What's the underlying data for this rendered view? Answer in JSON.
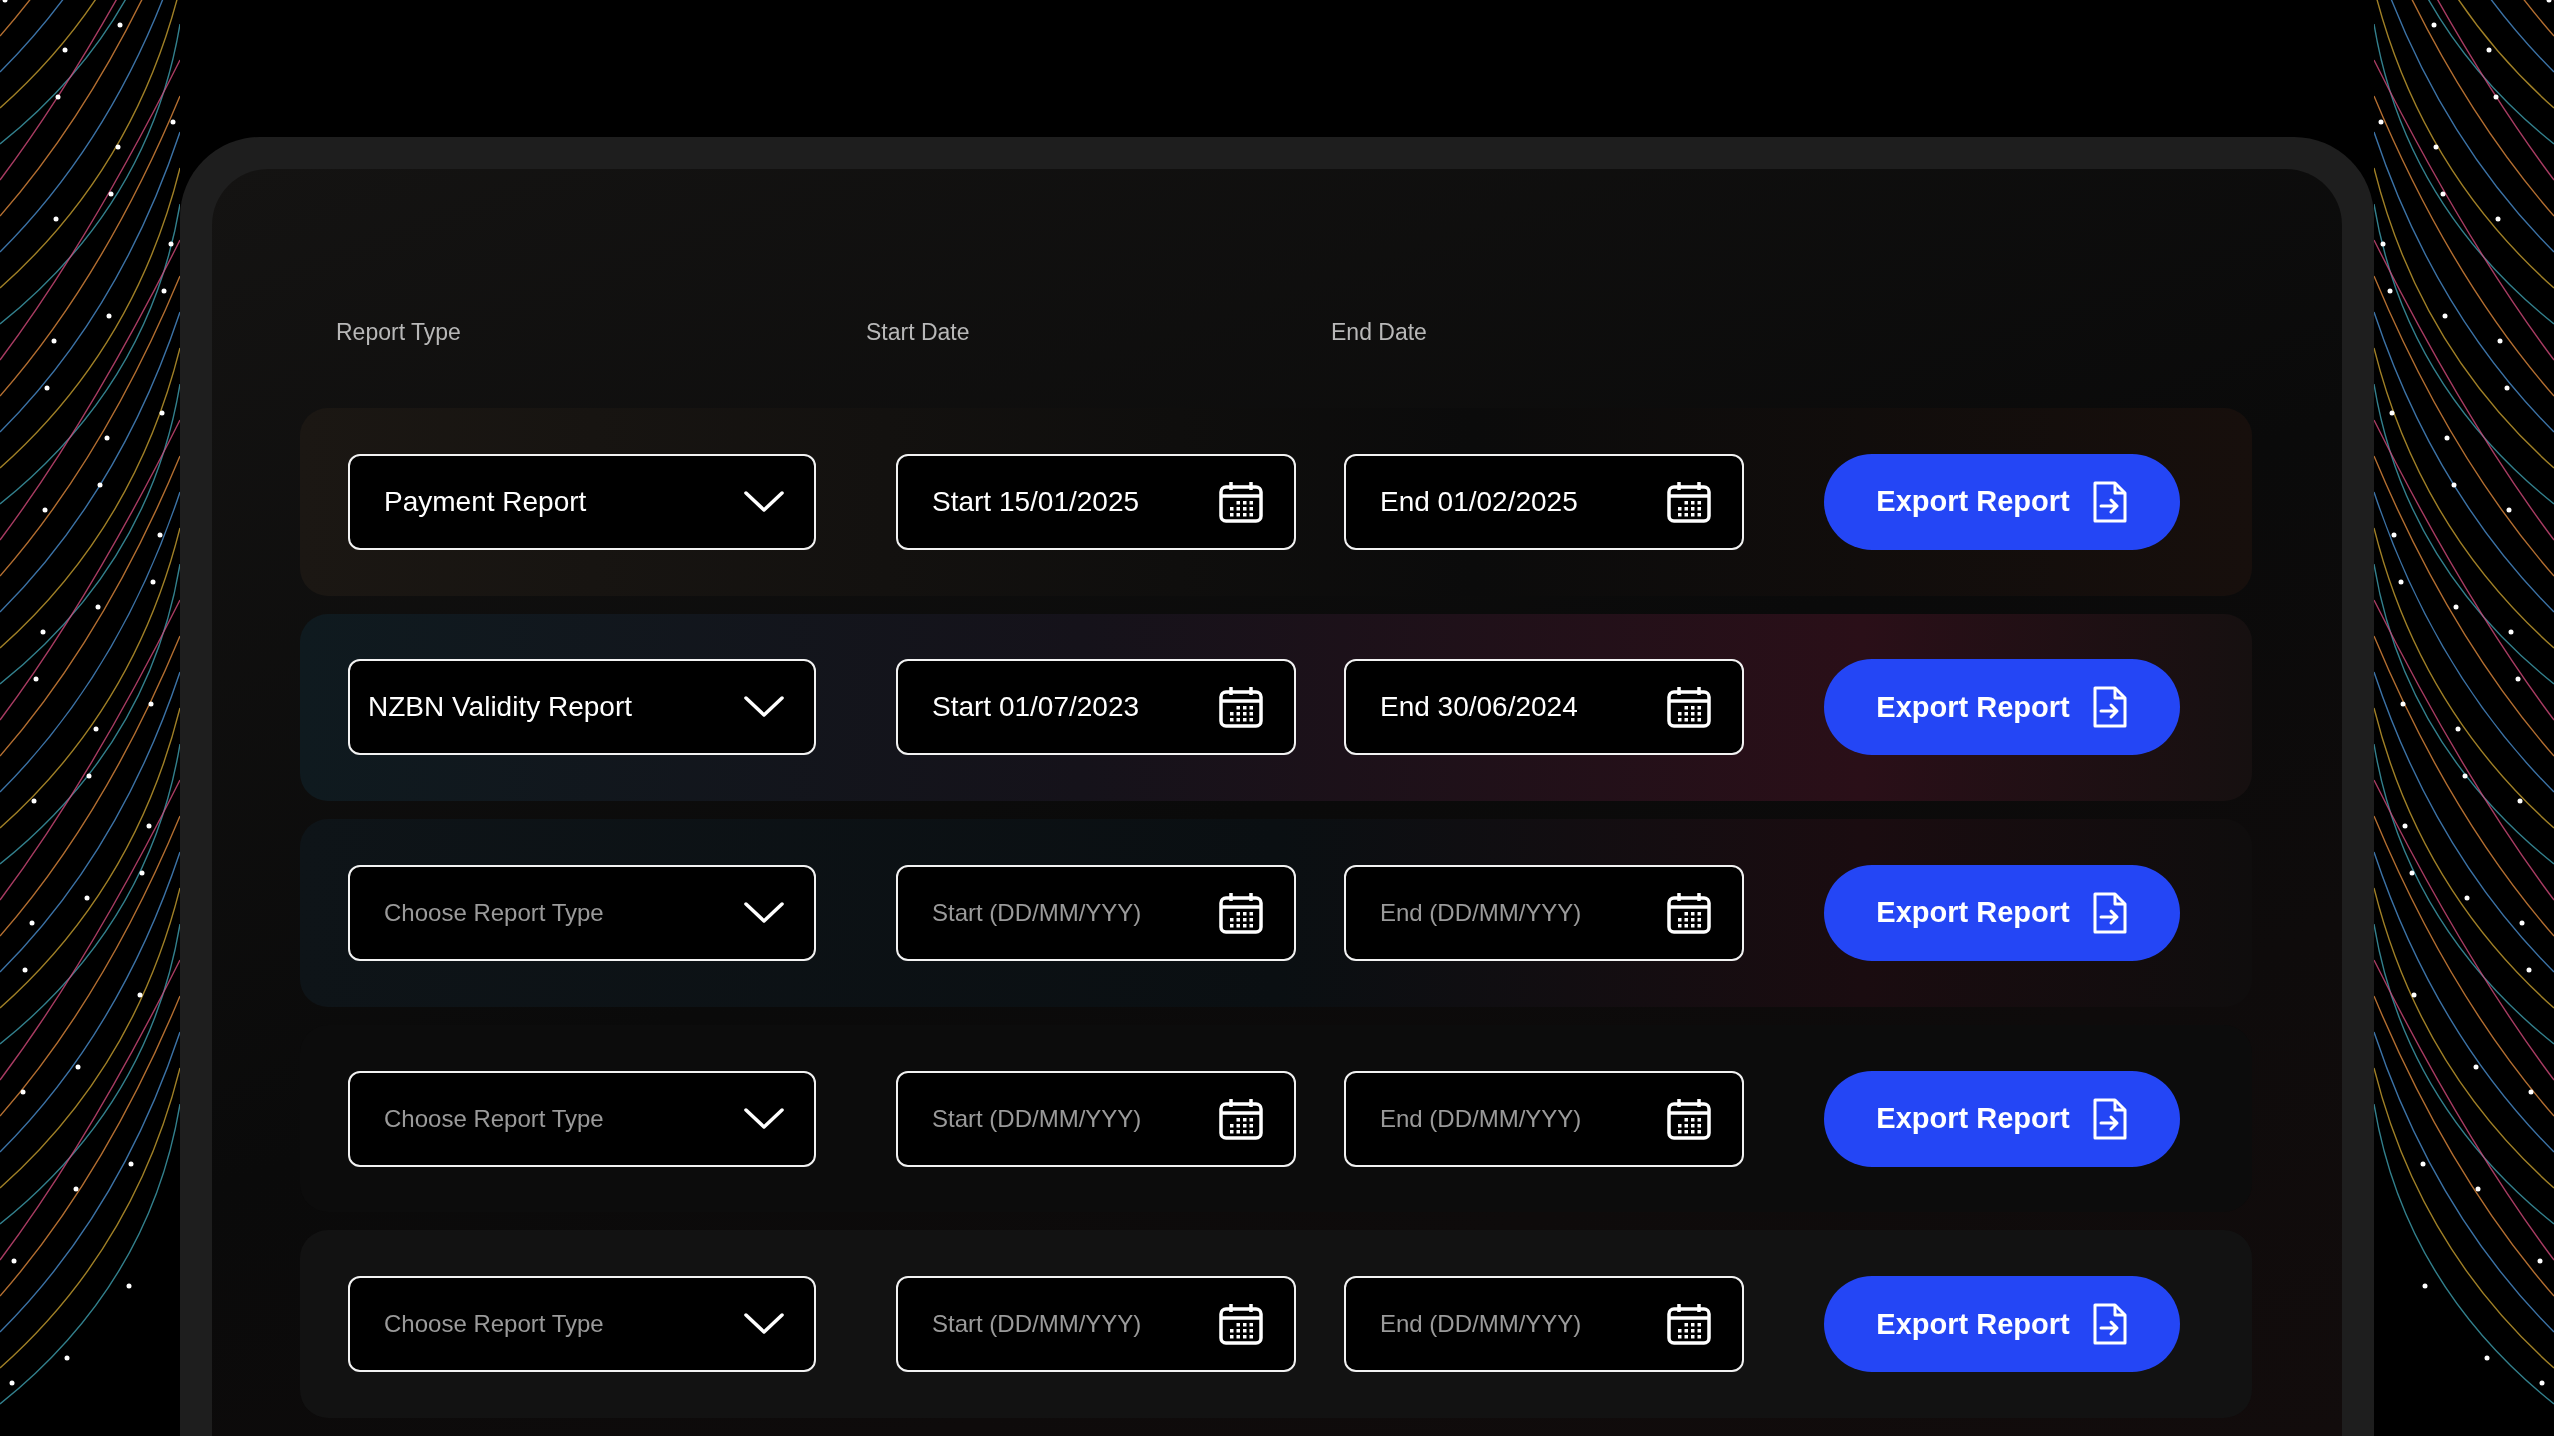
{
  "columns": [
    "Report Type",
    "Start Date",
    "End Date"
  ],
  "rows": [
    {
      "report_type": {
        "value": "Payment Report"
      },
      "start": {
        "value": "Start 15/01/2025"
      },
      "end": {
        "value": "End 01/02/2025"
      },
      "action": "Export Report"
    },
    {
      "report_type": {
        "value": "NZBN Validity Report"
      },
      "start": {
        "value": "Start 01/07/2023"
      },
      "end": {
        "value": "End 30/06/2024"
      },
      "action": "Export Report"
    },
    {
      "report_type": {
        "placeholder": "Choose Report Type"
      },
      "start": {
        "placeholder": "Start (DD/MM/YYY)"
      },
      "end": {
        "placeholder": "End (DD/MM/YYY)"
      },
      "action": "Export Report"
    },
    {
      "report_type": {
        "placeholder": "Choose Report Type"
      },
      "start": {
        "placeholder": "Start (DD/MM/YYY)"
      },
      "end": {
        "placeholder": "End (DD/MM/YYY)"
      },
      "action": "Export Report"
    },
    {
      "report_type": {
        "placeholder": "Choose Report Type"
      },
      "start": {
        "placeholder": "Start (DD/MM/YYY)"
      },
      "end": {
        "placeholder": "End (DD/MM/YYY)"
      },
      "action": "Export Report"
    }
  ]
}
